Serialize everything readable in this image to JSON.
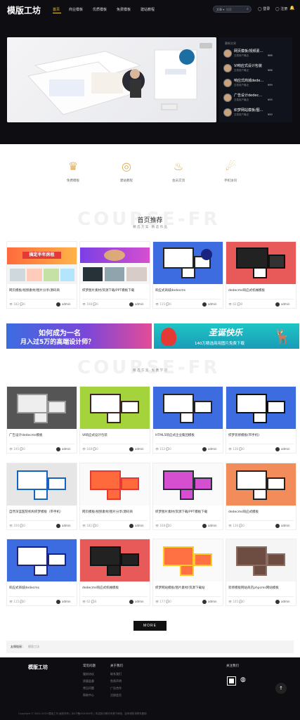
{
  "header": {
    "logo": "模版工坊",
    "nav": [
      "首页",
      "商业模板",
      "优质模板",
      "免费模板",
      "建站教程"
    ],
    "search_scope": "文章 ▾",
    "search_placeholder": "搜索",
    "login": "登录",
    "register": "注册"
  },
  "hero": {
    "sidebar_title": "最新交易",
    "items": [
      {
        "title": "网页模板/视频素…",
        "meta": "交易用户最近",
        "price": "¥88"
      },
      {
        "title": "VI响应式设计包装",
        "meta": "交易用户最近",
        "price": "¥66"
      },
      {
        "title": "响应式商城dede…",
        "meta": "交易用户最近",
        "price": "¥99"
      },
      {
        "title": "广告设计dedec…",
        "meta": "交易用户最近",
        "price": "¥55"
      },
      {
        "title": "织梦网站模板/图…",
        "meta": "交易用户最近",
        "price": "¥50"
      }
    ]
  },
  "features": [
    "免费模板",
    "建站教程",
    "会员交流",
    "手机访问"
  ],
  "section1": {
    "watermark": "COURSE-FR",
    "title": "首页推荐",
    "subtitle": "精 选 方 案  ·  精 选 作 品"
  },
  "section2": {
    "watermark": "COURSE-FR",
    "subtitle": "精 选 方 案  ·  免 费 学 习"
  },
  "cards_row1": [
    {
      "title": "网页模板/视频素材/图片分享/源码商",
      "views": "182",
      "comments": "0",
      "author": "admin",
      "thumb": "红色"
    },
    {
      "title": "织梦图片素材/资源下载/PPT模板下载",
      "views": "168",
      "comments": "0",
      "author": "admin",
      "thumb": "紫色"
    },
    {
      "title": "响应式商城dedecms",
      "views": "115",
      "comments": "0",
      "author": "admin",
      "thumb": "蓝色"
    },
    {
      "title": "dedecms响应式机械模板",
      "views": "62",
      "comments": "0",
      "author": "admin",
      "thumb": "红黑"
    }
  ],
  "banners": {
    "left_line1": "如何成为一名",
    "left_line2": "月入过5万的高端设计师？",
    "right_line1": "圣诞快乐",
    "right_line2": "140万精选商用图片免费下载"
  },
  "cards_grid": [
    {
      "title": "广告设计dedecms模板",
      "views": "195",
      "comments": "0",
      "author": "admin"
    },
    {
      "title": "VI响应式设计包装",
      "views": "168",
      "comments": "0",
      "author": "admin"
    },
    {
      "title": "HTML5响应式企业集团模板",
      "views": "152",
      "comments": "0",
      "author": "admin"
    },
    {
      "title": "织梦装修模板(带手机)",
      "views": "136",
      "comments": "0",
      "author": "admin"
    },
    {
      "title": "自然深蓝医院机构织梦模板（带手机）",
      "views": "100",
      "comments": "0",
      "author": "admin"
    },
    {
      "title": "网页模板/视频素材/图片分享/源码商",
      "views": "182",
      "comments": "0",
      "author": "admin"
    },
    {
      "title": "织梦图片素材/资源下载/PPT模板下载",
      "views": "168",
      "comments": "0",
      "author": "admin"
    },
    {
      "title": "dedecms响应式模板",
      "views": "136",
      "comments": "0",
      "author": "admin"
    },
    {
      "title": "响应式商城dedecms",
      "views": "115",
      "comments": "0",
      "author": "admin"
    },
    {
      "title": "dedecms响应式机械模板",
      "views": "62",
      "comments": "0",
      "author": "admin"
    },
    {
      "title": "织梦网站模板/图片素材/资源下载站",
      "views": "177",
      "comments": "0",
      "author": "admin"
    },
    {
      "title": "装修模板网站商店phpcms网站模板",
      "views": "105",
      "comments": "0",
      "author": "admin"
    }
  ],
  "more_label": "MORE",
  "links": {
    "label": "友情链接：",
    "value": "模版工坊"
  },
  "footer": {
    "logo": "模版工坊",
    "col1_title": "常见问题",
    "col1_links": [
      "服务协议",
      "质量监督",
      "常见问题",
      "帮助中心"
    ],
    "col2_title": "关于我们",
    "col2_links": [
      "联系我们",
      "免责声明",
      "广告合作",
      "注册会员"
    ],
    "follow_title": "关注我们",
    "copyright": "Copyright © 2002-2019 模版工坊 版权所有 | 京ICP备XXXXXX号 | 本站部分素材来源于网络，如有侵权请联系删除"
  },
  "colors": {
    "accent": "#f2c84b",
    "dark": "#0d0d12",
    "feature": "#e2ac53"
  }
}
